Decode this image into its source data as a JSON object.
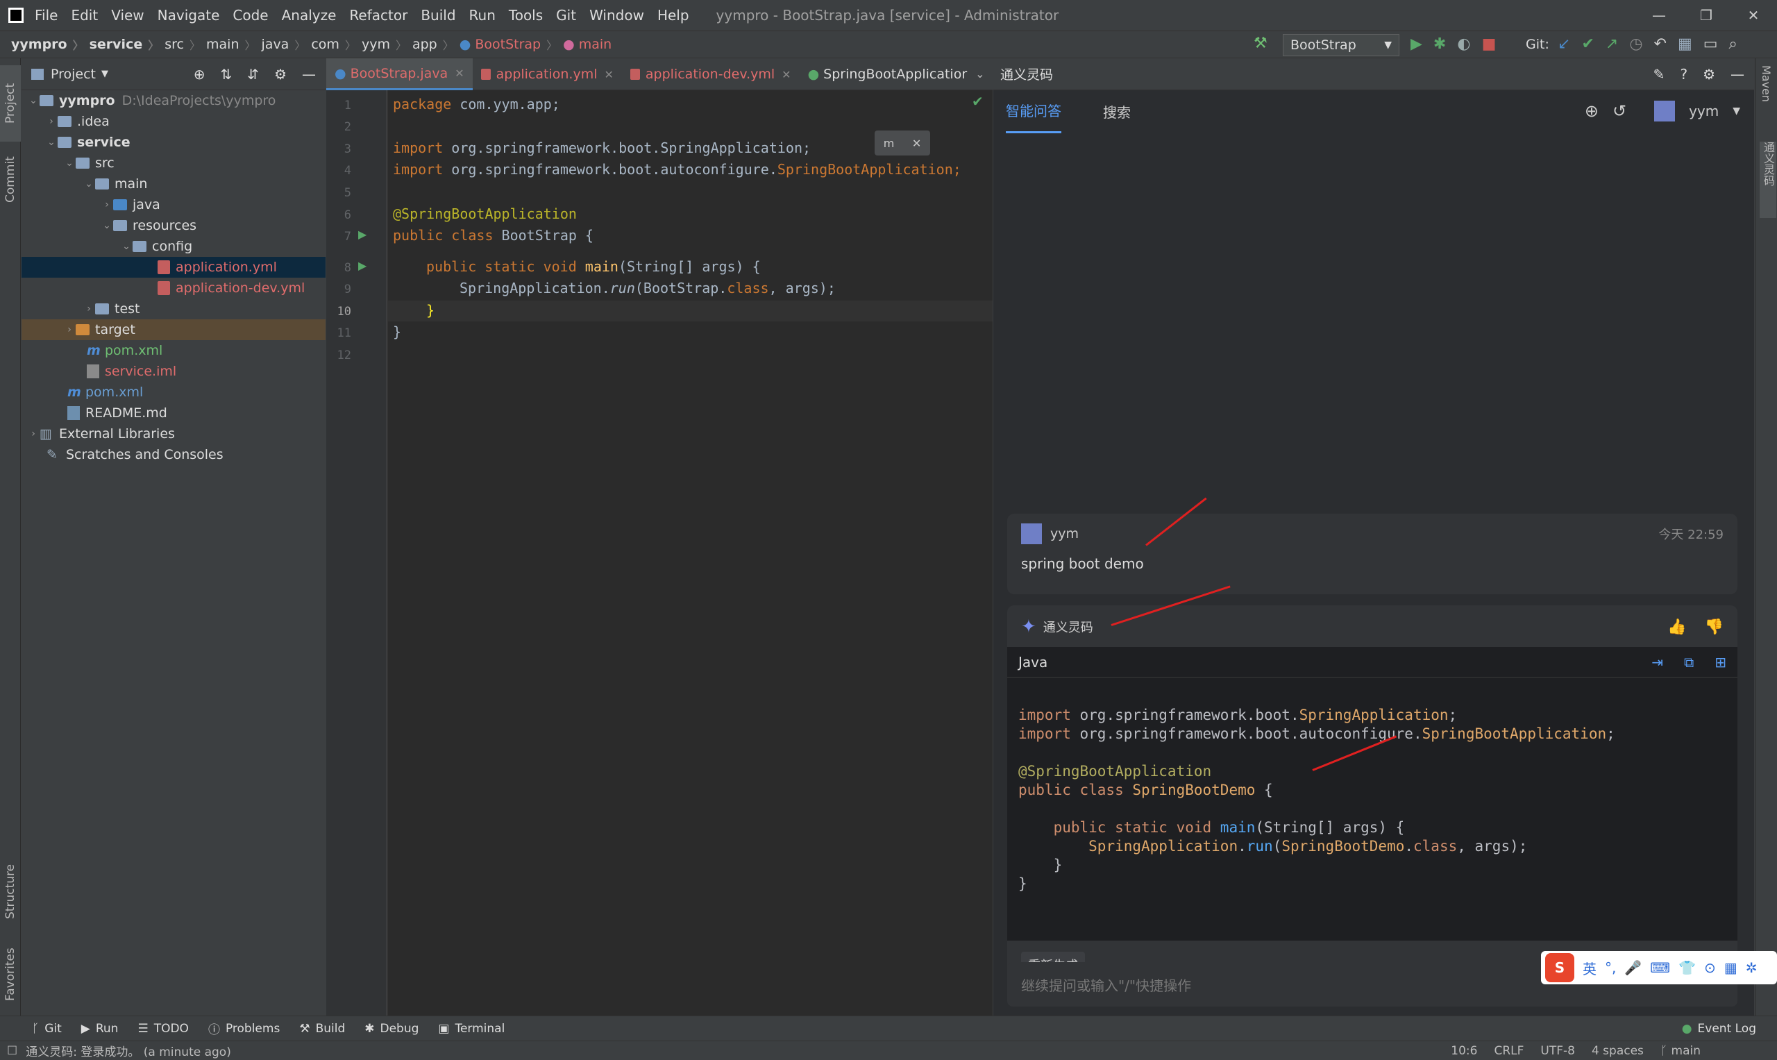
{
  "menu": {
    "items": [
      "File",
      "Edit",
      "View",
      "Navigate",
      "Code",
      "Analyze",
      "Refactor",
      "Build",
      "Run",
      "Tools",
      "Git",
      "Window",
      "Help"
    ],
    "title": "yympro - BootStrap.java [service] - Administrator"
  },
  "breadcrumb": [
    "yympro",
    "service",
    "src",
    "main",
    "java",
    "com",
    "yym",
    "app",
    "BootStrap",
    "main"
  ],
  "toolbar": {
    "run_config": "BootStrap",
    "git_label": "Git:"
  },
  "project": {
    "header": "Project",
    "rows": [
      {
        "label": "yympro",
        "path": "D:\\IdeaProjects\\yympro"
      },
      {
        "label": ".idea"
      },
      {
        "label": "service"
      },
      {
        "label": "src"
      },
      {
        "label": "main"
      },
      {
        "label": "java"
      },
      {
        "label": "resources"
      },
      {
        "label": "config"
      },
      {
        "label": "application.yml"
      },
      {
        "label": "application-dev.yml"
      },
      {
        "label": "test"
      },
      {
        "label": "target"
      },
      {
        "label": "pom.xml"
      },
      {
        "label": "service.iml"
      },
      {
        "label": "pom.xml"
      },
      {
        "label": "README.md"
      },
      {
        "label": "External Libraries"
      },
      {
        "label": "Scratches and Consoles"
      }
    ]
  },
  "editor": {
    "tabs": [
      "BootStrap.java",
      "application.yml",
      "application-dev.yml",
      "SpringBootApplicatior"
    ],
    "lines": [
      "1",
      "2",
      "3",
      "4",
      "5",
      "6",
      "7",
      "8",
      "9",
      "10",
      "11",
      "12"
    ],
    "code": {
      "l1_kw": "package",
      "l1_rest": " com.yym.app;",
      "l3_kw": "import",
      "l3_rest": " org.springframework.boot.SpringApplication;",
      "l4_kw": "import",
      "l4_rest": " org.springframework.boot.autoconfigure.",
      "l4_cls": "SpringBootApplication",
      "l6": "@SpringBootApplication",
      "l7_kw": "public class",
      "l7_rest": " BootStrap {",
      "l8_kw": "public static void",
      "l8_fn": " main",
      "l8_rest": "(String[] args) {",
      "l9_a": "SpringApplication.",
      "l9_run": "run",
      "l9_b": "(BootStrap.",
      "l9_class": "class",
      "l9_c": ", args);",
      "l10": "}",
      "l11": "}"
    }
  },
  "assistant": {
    "title": "通义灵码",
    "tabs": [
      "智能问答",
      "搜索"
    ],
    "user": "yym",
    "user_msg": {
      "name": "yym",
      "time": "今天 22:59",
      "text": "spring boot demo"
    },
    "bot_name": "通义灵码",
    "lang": "Java",
    "code_lines": [
      "import org.springframework.boot.SpringApplication;",
      "import org.springframework.boot.autoconfigure.SpringBootApplication;",
      "",
      "@SpringBootApplication",
      "public class SpringBootDemo {",
      "",
      "    public static void main(String[] args) {",
      "        SpringApplication.run(SpringBootDemo.class, args);",
      "    }",
      "}"
    ],
    "regen": "重新生成",
    "input_placeholder": "继续提问或输入\"/\"快捷操作"
  },
  "left_strip": [
    "Project",
    "Commit",
    "Structure",
    "Favorites"
  ],
  "right_strip": [
    "Maven",
    "通义灵码"
  ],
  "bottom_tabs": [
    "Git",
    "Run",
    "TODO",
    "Problems",
    "Build",
    "Debug",
    "Terminal"
  ],
  "event_log": "Event Log",
  "status": {
    "message": "通义灵码: 登录成功。 (a minute ago)",
    "position": "10:6",
    "line_sep": "CRLF",
    "encoding": "UTF-8",
    "indent": "4 spaces",
    "branch": "main"
  },
  "ime": {
    "lang": "英"
  }
}
